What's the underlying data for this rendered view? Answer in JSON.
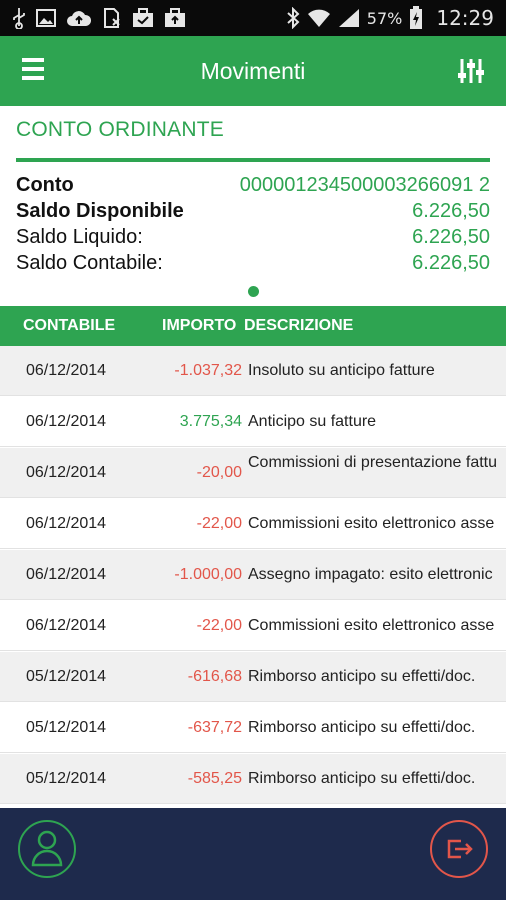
{
  "status_bar": {
    "battery": "57%",
    "time": "12:29"
  },
  "app_bar": {
    "title": "Movimenti"
  },
  "account": {
    "section_title": "CONTO ORDINANTE",
    "rows": [
      {
        "label": "Conto",
        "value": "000001234500003266091 2"
      },
      {
        "label": "Saldo Disponibile",
        "value": "6.226,50"
      },
      {
        "label": "Saldo Liquido:",
        "value": "6.226,50"
      },
      {
        "label": "Saldo Contabile:",
        "value": "6.226,50"
      }
    ]
  },
  "table": {
    "headers": [
      "CONTABILE",
      "IMPORTO",
      "DESCRIZIONE"
    ],
    "rows": [
      {
        "date": "06/12/2014",
        "amount": "-1.037,32",
        "desc": "Insoluto su anticipo fatture"
      },
      {
        "date": "06/12/2014",
        "amount": "3.775,34",
        "desc": "Anticipo su fatture"
      },
      {
        "date": "06/12/2014",
        "amount": "-20,00",
        "desc": "Commissioni di presentazione fattu"
      },
      {
        "date": "06/12/2014",
        "amount": "-22,00",
        "desc": "Commissioni esito elettronico asse"
      },
      {
        "date": "06/12/2014",
        "amount": "-1.000,00",
        "desc": "Assegno impagato: esito elettronic"
      },
      {
        "date": "06/12/2014",
        "amount": "-22,00",
        "desc": "Commissioni esito elettronico asse"
      },
      {
        "date": "05/12/2014",
        "amount": "-616,68",
        "desc": "Rimborso anticipo su effetti/doc."
      },
      {
        "date": "05/12/2014",
        "amount": "-637,72",
        "desc": "Rimborso anticipo su effetti/doc."
      },
      {
        "date": "05/12/2014",
        "amount": "-585,25",
        "desc": "Rimborso anticipo su effetti/doc."
      }
    ]
  },
  "colors": {
    "brand_green": "#2ea451",
    "negative_red": "#e2564a",
    "bottom_bar": "#1e2a4c"
  },
  "icons": {
    "menu": "hamburger-menu-icon",
    "filter": "sliders-filter-icon",
    "profile": "user-profile-icon",
    "logout": "logout-icon"
  }
}
